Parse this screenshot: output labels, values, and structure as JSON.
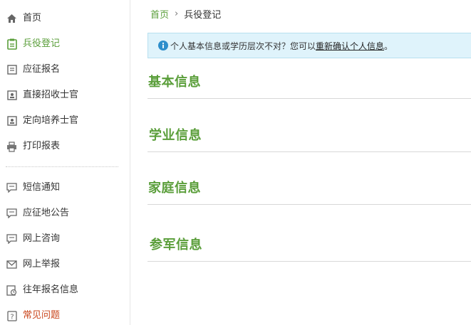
{
  "sidebar": {
    "items": [
      {
        "label": "首页",
        "icon": "home-icon"
      },
      {
        "label": "兵役登记",
        "icon": "clipboard-icon"
      },
      {
        "label": "应征报名",
        "icon": "form-icon"
      },
      {
        "label": "直接招收士官",
        "icon": "id-card-icon"
      },
      {
        "label": "定向培养士官",
        "icon": "id-card-icon"
      },
      {
        "label": "打印报表",
        "icon": "printer-icon"
      },
      {
        "label": "短信通知",
        "icon": "message-icon"
      },
      {
        "label": "应征地公告",
        "icon": "message-icon"
      },
      {
        "label": "网上咨询",
        "icon": "message-icon"
      },
      {
        "label": "网上举报",
        "icon": "mail-icon"
      },
      {
        "label": "往年报名信息",
        "icon": "history-doc-icon"
      },
      {
        "label": "常见问题",
        "icon": "question-icon"
      }
    ],
    "active_item": "兵役登记"
  },
  "breadcrumb": {
    "home": "首页",
    "separator": "›",
    "current": "兵役登记"
  },
  "alert": {
    "text_before": "个人基本信息或学历层次不对？您可以",
    "link": "重新确认个人信息",
    "text_after": "。"
  },
  "sections": [
    {
      "title": "基本信息"
    },
    {
      "title": "学业信息"
    },
    {
      "title": "家庭信息"
    },
    {
      "title": "参军信息"
    }
  ],
  "colors": {
    "accent_green": "#5a9e3a",
    "warning_orange": "#c9441a",
    "alert_bg": "#dff3fb",
    "info_blue": "#2d8ecb"
  }
}
